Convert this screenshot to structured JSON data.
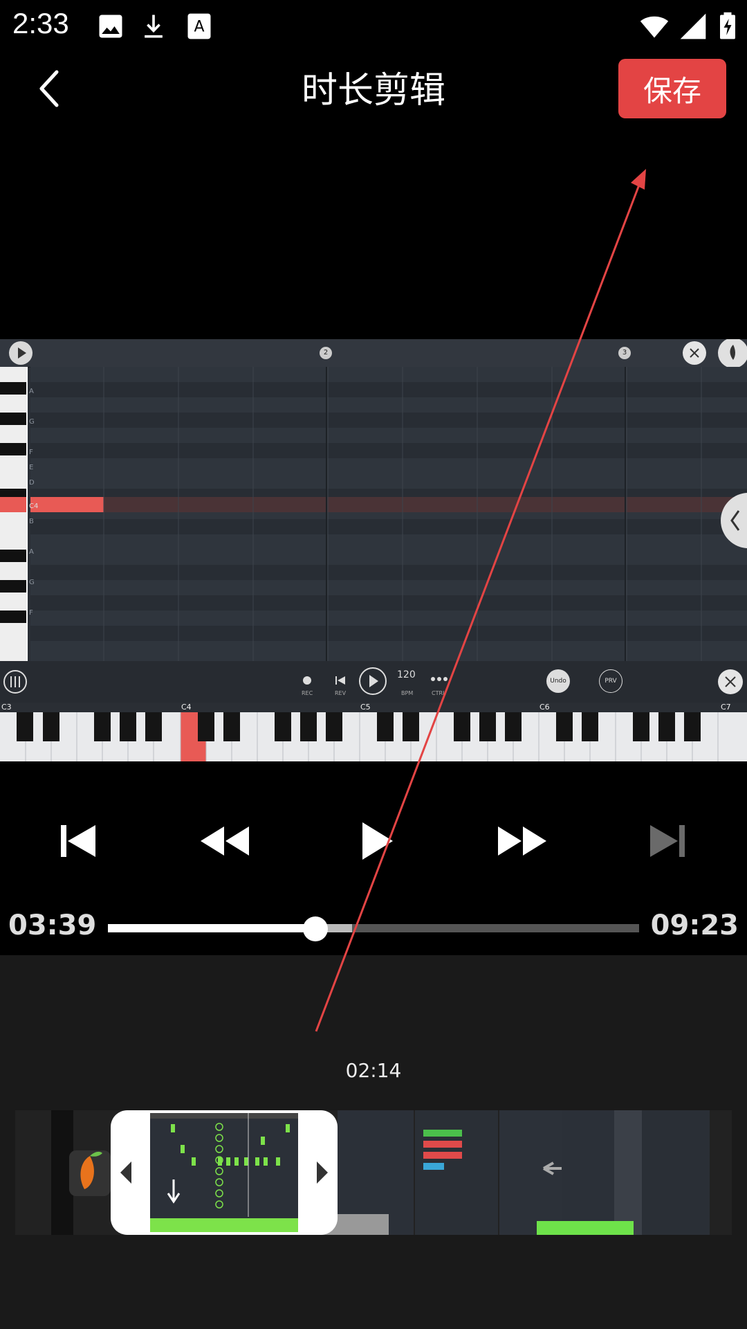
{
  "status_bar": {
    "time": "2:33"
  },
  "header": {
    "title": "时长剪辑",
    "save_label": "保存"
  },
  "video_frame": {
    "timeline_markers": [
      "2",
      "3"
    ],
    "note_labels_left": [
      "A",
      "G",
      "F",
      "E",
      "D",
      "C4",
      "B",
      "A",
      "G",
      "F"
    ],
    "controls": {
      "rec": "REC",
      "rev": "REV",
      "bpm_value": "120",
      "bpm": "BPM",
      "ctrl": "CTRL",
      "undo": "Undo",
      "prv": "PRV"
    },
    "keyboard_labels": [
      "C3",
      "C4",
      "C5",
      "C6",
      "C7"
    ]
  },
  "player": {
    "current_time": "03:39",
    "total_time": "09:23",
    "progress": 0.39,
    "buffered": 0.46
  },
  "trim": {
    "selected_duration": "02:14"
  },
  "colors": {
    "accent": "#e34444",
    "background": "#000000"
  }
}
